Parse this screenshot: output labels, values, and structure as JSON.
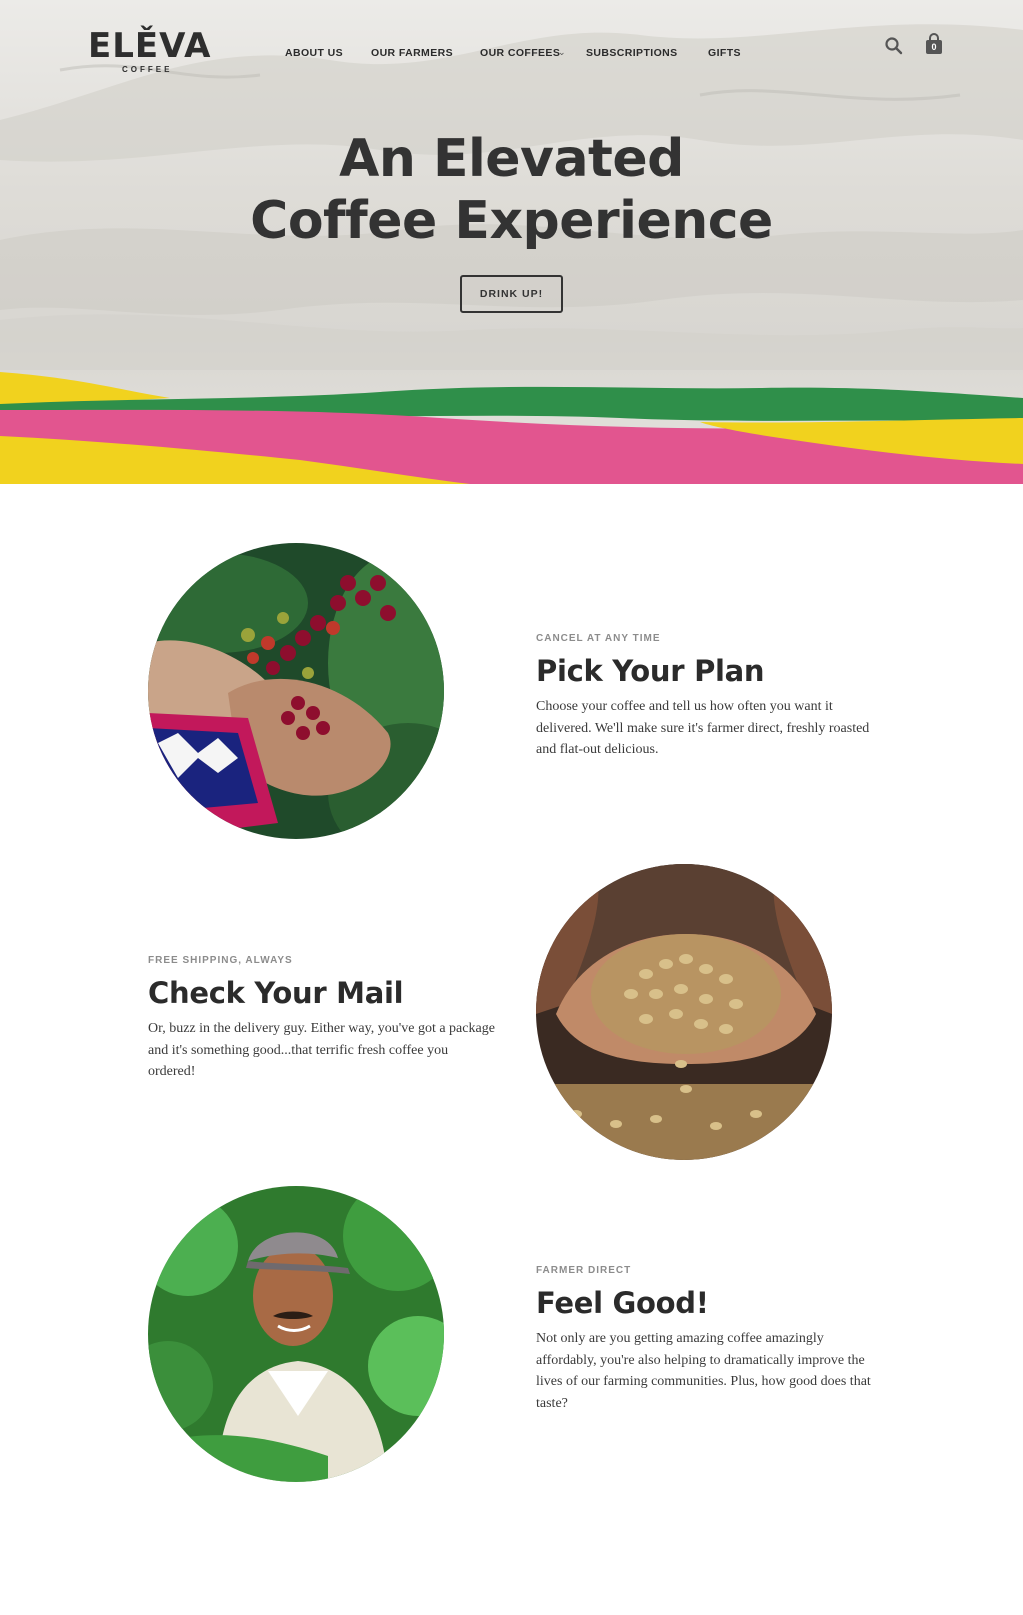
{
  "brand": {
    "name": "ELĚVA",
    "subtitle": "COFFEE"
  },
  "nav": {
    "items": [
      {
        "label": "ABOUT US"
      },
      {
        "label": "OUR FARMERS"
      },
      {
        "label": "OUR COFFEES",
        "has_dropdown": true
      },
      {
        "label": "SUBSCRIPTIONS"
      },
      {
        "label": "GIFTS"
      }
    ],
    "search_icon": "search-icon",
    "cart_icon": "shopping-bag-icon",
    "cart_count": "0"
  },
  "hero": {
    "title_line1": "An Elevated",
    "title_line2": "Coffee Experience",
    "cta_label": "DRINK UP!"
  },
  "features": [
    {
      "eyebrow": "CANCEL AT ANY TIME",
      "title": "Pick Your Plan",
      "body": "Choose your coffee and tell us how often you want it delivered. We'll make sure it's farmer direct, freshly roasted and flat-out delicious."
    },
    {
      "eyebrow": "FREE SHIPPING, ALWAYS",
      "title": "Check Your Mail",
      "body": "Or, buzz in the delivery guy. Either way, you've got a package and it's something good...that terrific fresh coffee you ordered!"
    },
    {
      "eyebrow": "FARMER DIRECT",
      "title": "Feel Good!",
      "body": "Not only are you getting amazing coffee amazingly affordably, you're also helping to dramatically improve the lives of our farming communities. Plus, how good does that taste?"
    }
  ],
  "colors": {
    "band_yellow": "#f1d21e",
    "band_green": "#2f8f4a",
    "band_pink": "#e2558f",
    "text_dark": "#2b2b2b",
    "eyebrow_gray": "#8c8c8c"
  }
}
